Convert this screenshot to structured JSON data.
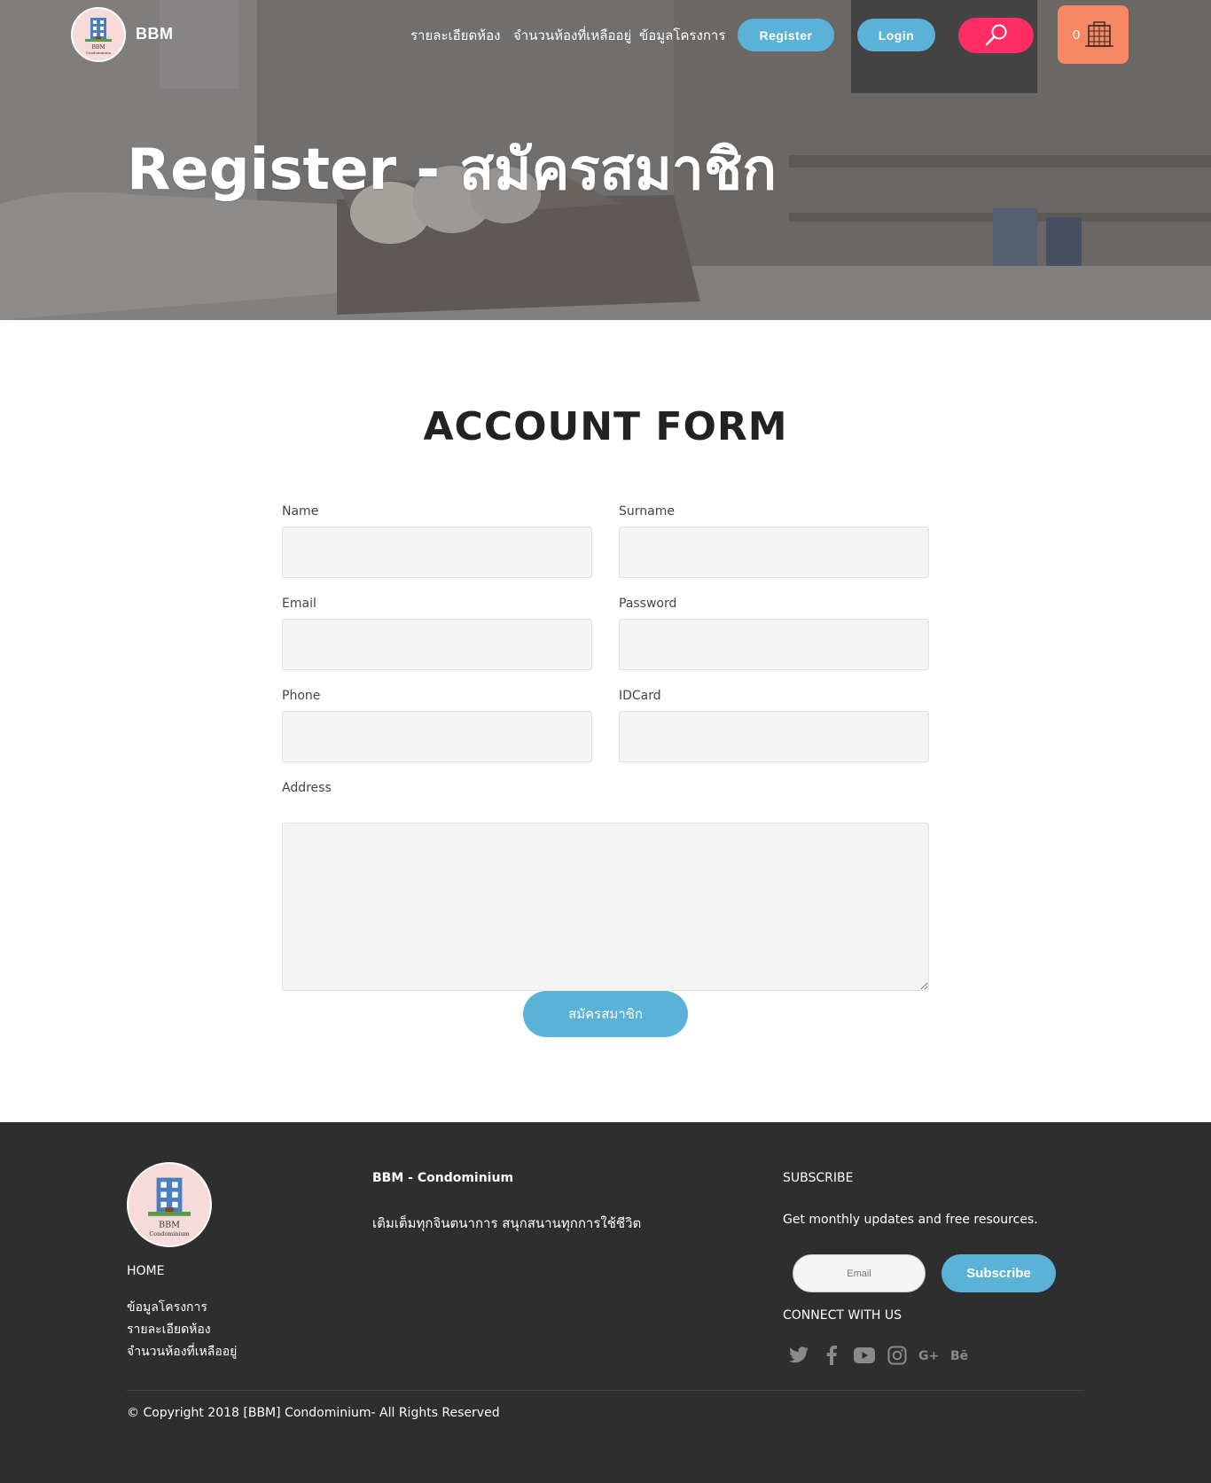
{
  "header": {
    "brand": "BBM",
    "nav": [
      "รายละเอียดห้อง",
      "จำนวนห้องที่เหลืออยู่",
      "ข้อมูลโครงการ"
    ],
    "register_label": "Register",
    "login_label": "Login",
    "cart_count": "0",
    "search_icon": "search-icon",
    "cart_icon": "building-icon"
  },
  "hero": {
    "title": "Register - สมัครสมาชิก"
  },
  "form": {
    "title": "ACCOUNT FORM",
    "fields": {
      "name": {
        "label": "Name",
        "value": ""
      },
      "surname": {
        "label": "Surname",
        "value": ""
      },
      "email": {
        "label": "Email",
        "value": ""
      },
      "password": {
        "label": "Password",
        "value": ""
      },
      "phone": {
        "label": "Phone",
        "value": ""
      },
      "idcard": {
        "label": "IDCard",
        "value": ""
      },
      "address": {
        "label": "Address",
        "value": ""
      }
    },
    "submit_label": "สมัครสมาชิก"
  },
  "footer": {
    "home_label": "HOME",
    "links": [
      "ข้อมูลโครงการ",
      "รายละเอียดห้อง",
      "จำนวนห้องที่เหลืออยู่"
    ],
    "brand_title": "BBM - Condominium",
    "tagline": "เติมเต็มทุกจินตนาการ สนุกสนานทุกการใช้ชีวิต",
    "subscribe_title": "SUBSCRIBE",
    "subscribe_text": "Get monthly updates and free resources.",
    "email_placeholder": "Email",
    "subscribe_button": "Subscribe",
    "connect_title": "CONNECT WITH US",
    "social_icons": [
      "twitter-icon",
      "facebook-icon",
      "youtube-icon",
      "instagram-icon",
      "google-plus-icon",
      "behance-icon"
    ],
    "copyright": "© Copyright 2018 [BBM] Condominium- All Rights Reserved"
  },
  "colors": {
    "accent_blue": "#5ab3d6",
    "search_pink": "#ff2d63",
    "cart_orange": "#f78762",
    "footer_bg": "#2e2e2e",
    "input_bg": "#f4f4f4"
  }
}
